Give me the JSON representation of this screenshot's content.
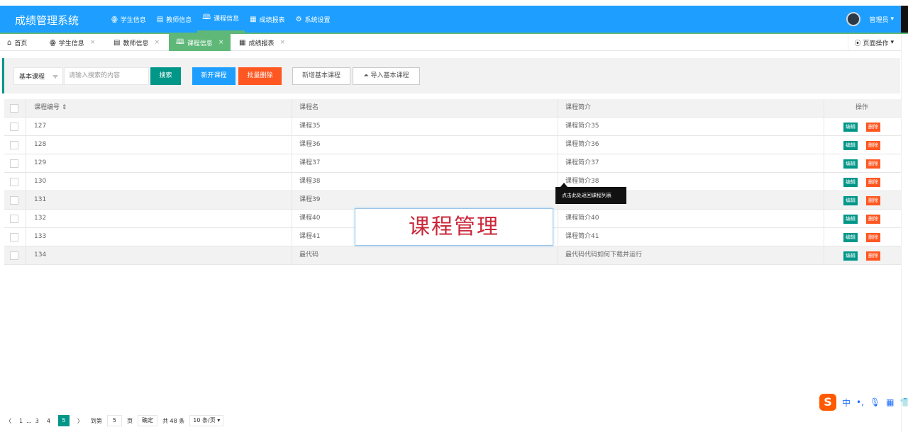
{
  "header": {
    "title": "成绩管理系统",
    "nav": [
      {
        "icon": "people-icon",
        "glyph": "ꙮ",
        "label": "学生信息",
        "active": false
      },
      {
        "icon": "document-icon",
        "glyph": "▤",
        "label": "教师信息",
        "active": false
      },
      {
        "icon": "book-icon",
        "glyph": "🕮",
        "label": "课程信息",
        "active": true
      },
      {
        "icon": "table-icon",
        "glyph": "▦",
        "label": "成绩报表",
        "active": false
      },
      {
        "icon": "gear-icon",
        "glyph": "⚙",
        "label": "系统设置",
        "active": false
      }
    ],
    "user": "管理员",
    "user_caret": "▾"
  },
  "tabs": [
    {
      "glyph": "⌂",
      "label": "首页",
      "close": ""
    },
    {
      "glyph": "ꙮ",
      "label": "学生信息",
      "close": "×"
    },
    {
      "glyph": "▤",
      "label": "教师信息",
      "close": "×"
    },
    {
      "glyph": "🕮",
      "label": "课程信息",
      "close": "×"
    },
    {
      "glyph": "▦",
      "label": "成绩报表",
      "close": "×"
    }
  ],
  "page_ops": {
    "glyph": "⦿",
    "label": "页面操作",
    "caret": "▾"
  },
  "toolbar": {
    "select_value": "基本课程",
    "search_placeholder": "请输入搜索的内容",
    "search_btn": "搜索",
    "new_course_btn": "新开课程",
    "batch_delete_btn": "批量删除",
    "add_basic_btn": "新增基本课程",
    "import_basic_btn": "⏶ 导入基本课程"
  },
  "table": {
    "headers": [
      "课程编号 ⇕",
      "课程名",
      "课程简介",
      "操作"
    ],
    "edit_label": "编辑",
    "delete_label": "删除",
    "rows": [
      {
        "id": "127",
        "name": "课程35",
        "intro": "课程简介35"
      },
      {
        "id": "128",
        "name": "课程36",
        "intro": "课程简介36"
      },
      {
        "id": "129",
        "name": "课程37",
        "intro": "课程简介37"
      },
      {
        "id": "130",
        "name": "课程38",
        "intro": "课程简介38"
      },
      {
        "id": "131",
        "name": "课程39",
        "intro": ""
      },
      {
        "id": "132",
        "name": "课程40",
        "intro": "课程简介40"
      },
      {
        "id": "133",
        "name": "课程41",
        "intro": "课程简介41"
      },
      {
        "id": "134",
        "name": "最代码",
        "intro": "最代码代码如何下载并运行"
      }
    ]
  },
  "tooltip": "点击此处返回课程列表",
  "overlay_text": "课程管理",
  "pager": {
    "prev": "〈",
    "pages": [
      "1",
      "...",
      "3",
      "4"
    ],
    "current": "5",
    "next": "〉",
    "goto_label": "到第",
    "goto_value": "5",
    "page_unit": "页",
    "confirm": "确定",
    "total": "共 48 条",
    "per_page": "10 条/页 ▾"
  },
  "ime": {
    "logo": "S",
    "lang": "中",
    "punct": "•,",
    "mic": "🎙",
    "kbd": "▦",
    "more": "👕"
  },
  "colors": {
    "primary": "#1e9fff",
    "green": "#009688",
    "danger": "#ff5722",
    "tab_active": "#5fb878"
  }
}
